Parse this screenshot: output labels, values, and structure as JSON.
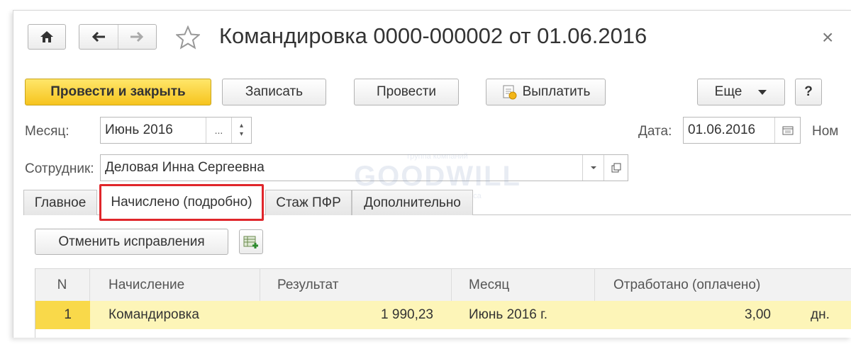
{
  "window": {
    "title": "Командировка 0000-000002 от 01.06.2016",
    "close_glyph": "×"
  },
  "nav": {
    "home_icon": "home-icon",
    "back_icon": "arrow-left-icon",
    "forward_icon": "arrow-right-icon",
    "favorite_icon": "star-icon"
  },
  "toolbar": {
    "post_and_close": "Провести и закрыть",
    "save": "Записать",
    "post": "Провести",
    "pay": "Выплатить",
    "more": "Еще",
    "help": "?"
  },
  "form": {
    "month_label": "Месяц:",
    "month_value": "Июнь 2016",
    "month_select_glyph": "...",
    "date_label": "Дата:",
    "date_value": "01.06.2016",
    "number_label": "Ном",
    "employee_label": "Сотрудник:",
    "employee_value": "Деловая Инна Сергеевна"
  },
  "tabs": [
    {
      "label": "Главное"
    },
    {
      "label": "Начислено (подробно)"
    },
    {
      "label": "Стаж ПФР"
    },
    {
      "label": "Дополнительно"
    }
  ],
  "active_tab": "Начислено (подробно)",
  "detail_toolbar": {
    "cancel_corrections": "Отменить исправления"
  },
  "table": {
    "columns": [
      "N",
      "Начисление",
      "Результат",
      "Месяц",
      "Отработано (оплачено)"
    ],
    "rows": [
      {
        "n": "1",
        "accrual": "Командировка",
        "result": "1 990,23",
        "month": "Июнь 2016 г.",
        "worked": "3,00",
        "unit": "дн."
      }
    ]
  },
  "watermark": {
    "top": "группа компаний",
    "name": "GOODWILL",
    "bottom": "технологии для бизнеса"
  },
  "colors": {
    "primary_button": "#f6c41e",
    "active_tab_highlight": "#e0262b",
    "selected_row": "#fdf5b8",
    "selected_cell": "#f9d94a"
  }
}
